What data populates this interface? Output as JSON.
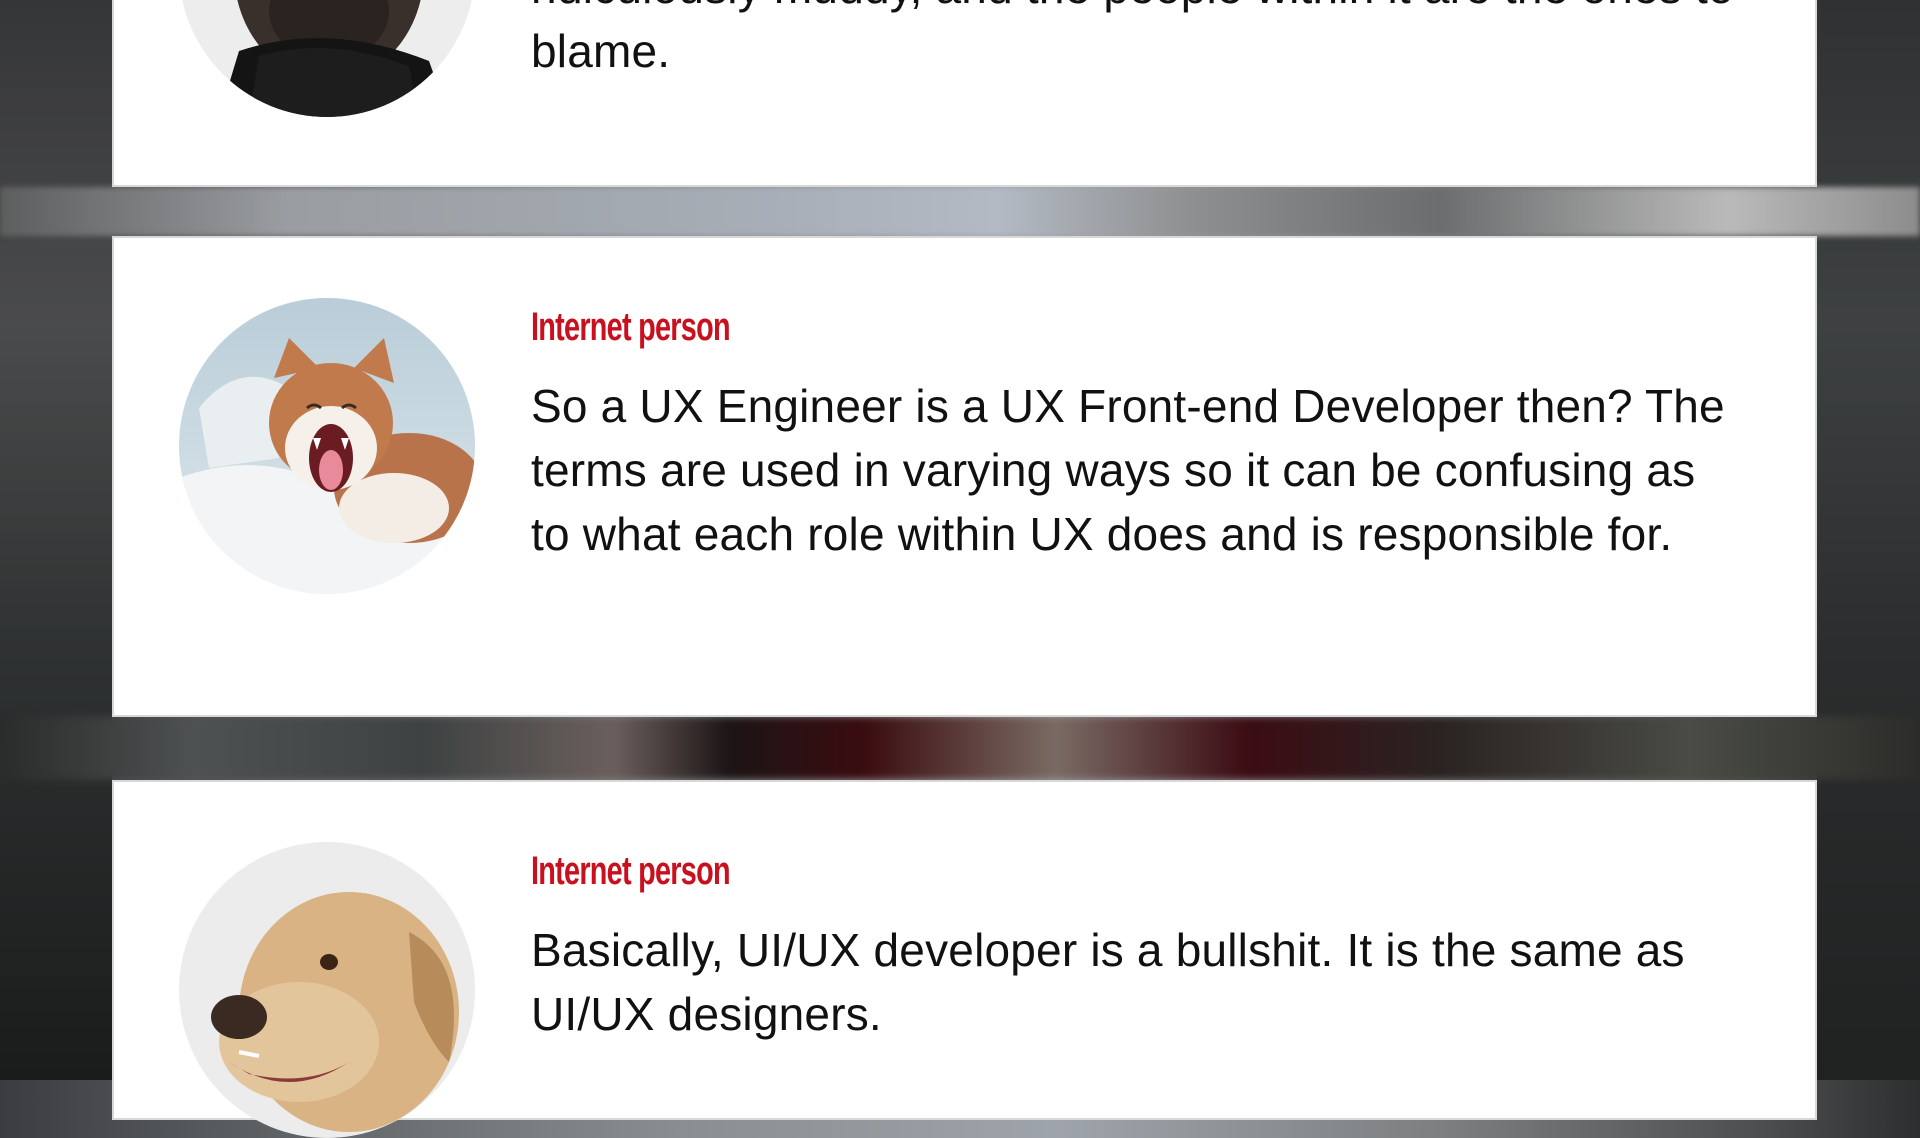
{
  "colors": {
    "author_accent": "#c8101e",
    "card_background": "#ffffff",
    "comment_text": "#111111"
  },
  "comments": [
    {
      "author": "",
      "text": "ridiculously muddy, and the people within it are the ones to blame.",
      "avatar": "pug-dog-avatar"
    },
    {
      "author": "Internet person",
      "text": "So a UX Engineer is a UX Front-end Developer then? The terms are used in varying ways so it can be confusing as to what each role within UX does and is responsible for.",
      "avatar": "yawning-cat-avatar"
    },
    {
      "author": "Internet person",
      "text": "Basically, UI/UX developer is a bullshit. It is the same as UI/UX designers.",
      "avatar": "labrador-dog-avatar"
    }
  ]
}
